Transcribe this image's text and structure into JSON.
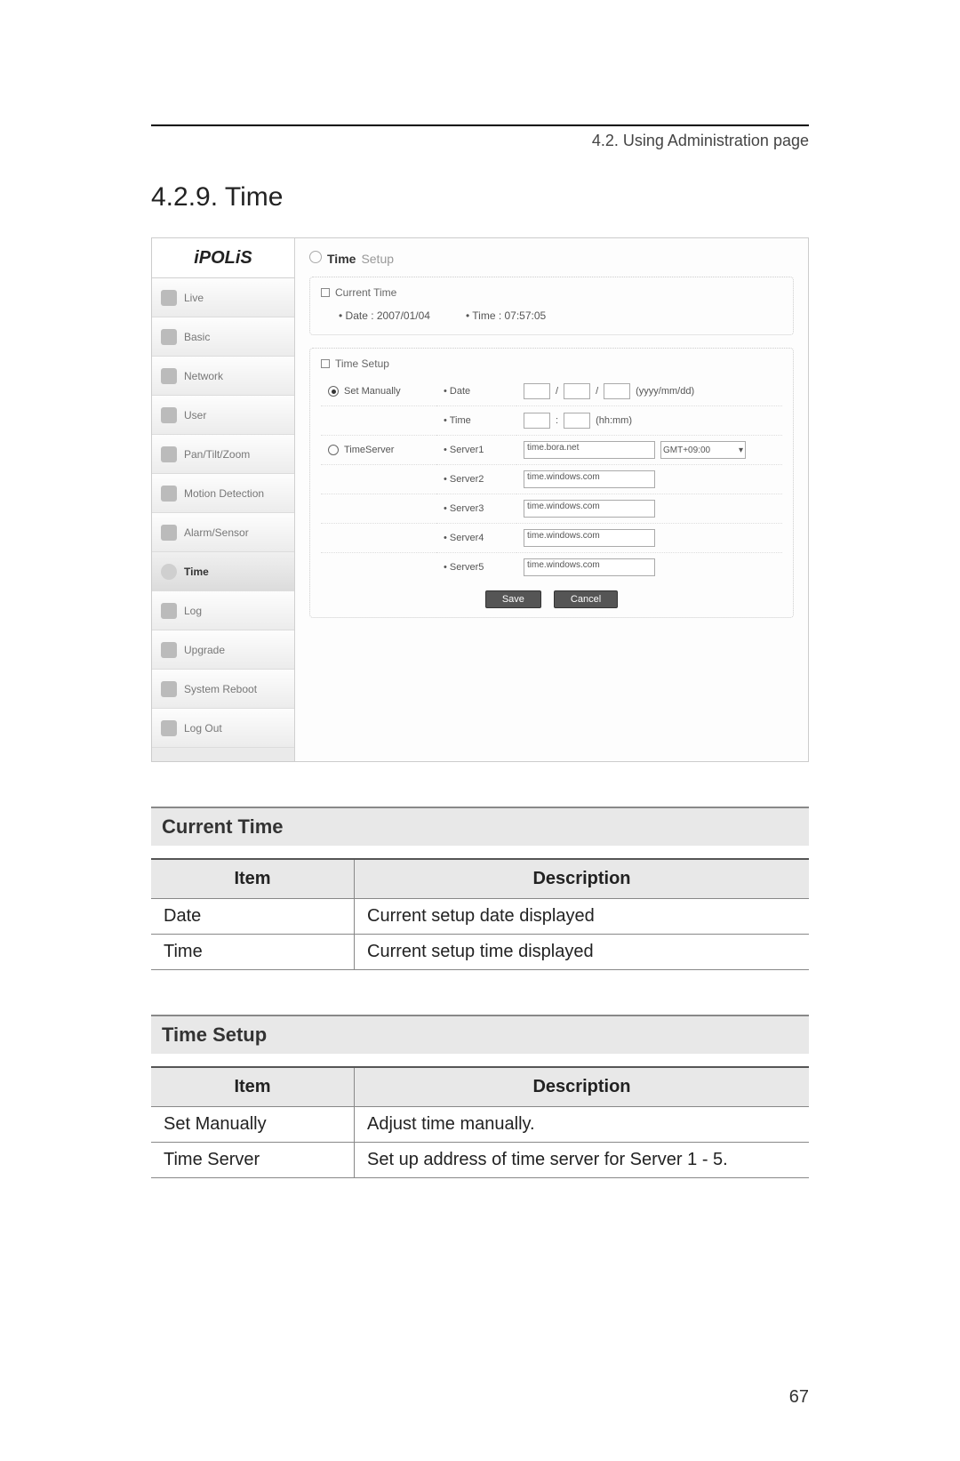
{
  "header": {
    "crumb": "4.2. Using Administration page"
  },
  "title": "4.2.9. Time",
  "screenshot": {
    "logo": "iPOLiS",
    "nav": [
      {
        "label": "Live"
      },
      {
        "label": "Basic"
      },
      {
        "label": "Network"
      },
      {
        "label": "User"
      },
      {
        "label": "Pan/Tilt/Zoom"
      },
      {
        "label": "Motion Detection"
      },
      {
        "label": "Alarm/Sensor"
      },
      {
        "label": "Time"
      },
      {
        "label": "Log"
      },
      {
        "label": "Upgrade"
      },
      {
        "label": "System Reboot"
      },
      {
        "label": "Log Out"
      }
    ],
    "page_title": {
      "bold": "Time",
      "light": "Setup"
    },
    "current_panel": {
      "title": "Current Time",
      "date_label": "• Date : 2007/01/04",
      "time_label": "• Time : 07:57:05"
    },
    "setup_panel": {
      "title": "Time Setup",
      "rows": {
        "manual_label": "Set Manually",
        "timeserver_label": "TimeServer",
        "date_label": "• Date",
        "date_hint": "(yyyy/mm/dd)",
        "time_label": "• Time",
        "time_hint": "(hh:mm)",
        "server_labels": [
          "• Server1",
          "• Server2",
          "• Server3",
          "• Server4",
          "• Server5"
        ],
        "server_values": [
          "time.bora.net",
          "time.windows.com",
          "time.windows.com",
          "time.windows.com",
          "time.windows.com"
        ],
        "gmt": "GMT+09:00"
      },
      "save_btn": "Save",
      "cancel_btn": "Cancel"
    }
  },
  "tables": {
    "current": {
      "heading": "Current Time",
      "th_item": "Item",
      "th_desc": "Description",
      "rows": [
        {
          "item": "Date",
          "desc": "Current setup date displayed"
        },
        {
          "item": "Time",
          "desc": "Current setup time displayed"
        }
      ]
    },
    "setup": {
      "heading": "Time Setup",
      "th_item": "Item",
      "th_desc": "Description",
      "rows": [
        {
          "item": "Set Manually",
          "desc": "Adjust time manually."
        },
        {
          "item": "Time Server",
          "desc": "Set up address of time server for Server 1 - 5."
        }
      ]
    }
  },
  "page_number": "67"
}
